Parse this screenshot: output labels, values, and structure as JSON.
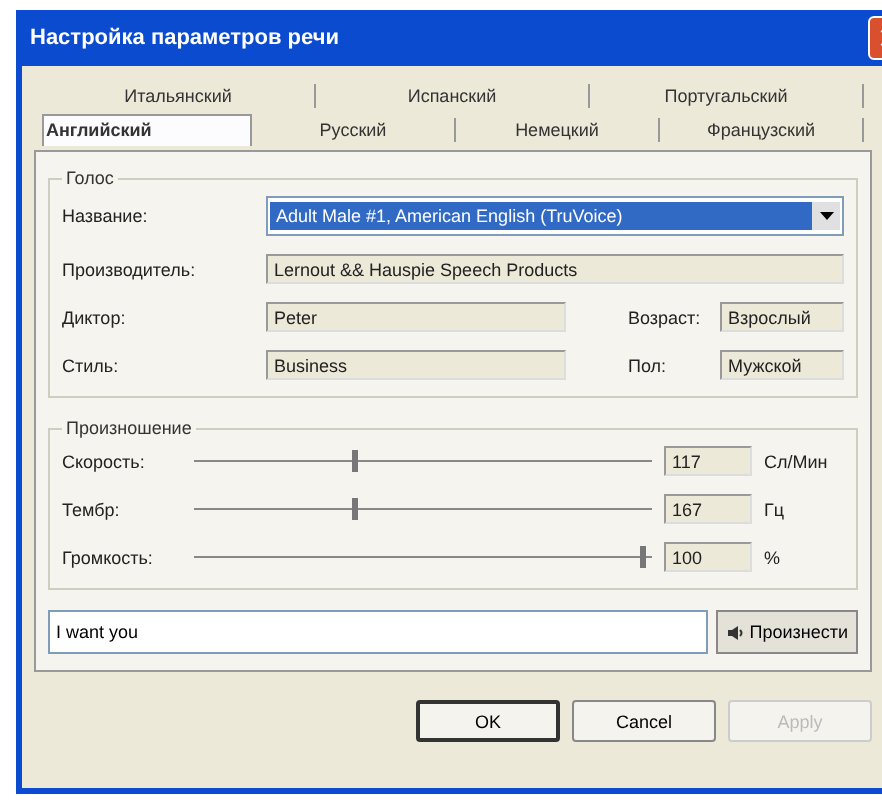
{
  "window": {
    "title": "Настройка параметров речи"
  },
  "tab_rows": [
    [
      {
        "label": "Итальянский",
        "selected": false
      },
      {
        "label": "Испанский",
        "selected": false
      },
      {
        "label": "Португальский",
        "selected": false
      }
    ],
    [
      {
        "label": "Английский",
        "selected": true
      },
      {
        "label": "Русский",
        "selected": false
      },
      {
        "label": "Немецкий",
        "selected": false
      },
      {
        "label": "Французский",
        "selected": false
      }
    ]
  ],
  "voice": {
    "title": "Голос",
    "name_label": "Название:",
    "name_value": "Adult Male #1, American English (TruVoice)",
    "maker_label": "Производитель:",
    "maker_value": "Lernout && Hauspie Speech Products",
    "speaker_label": "Диктор:",
    "speaker_value": "Peter",
    "age_label": "Возраст:",
    "age_value": "Взрослый",
    "style_label": "Стиль:",
    "style_value": "Business",
    "gender_label": "Пол:",
    "gender_value": "Мужской"
  },
  "pronunciation": {
    "title": "Произношение",
    "sliders": [
      {
        "label": "Скорость:",
        "level": 0.35,
        "reading": "117",
        "unit": "Сл/Мин"
      },
      {
        "label": "Тембр:",
        "level": 0.35,
        "reading": "167",
        "unit": "Гц"
      },
      {
        "label": "Громкость:",
        "level": 0.98,
        "reading": "100",
        "unit": "%"
      }
    ]
  },
  "test": {
    "value": "I want you",
    "button": "Произнести"
  },
  "buttons": [
    {
      "label": "OK",
      "disabled": false,
      "default": true
    },
    {
      "label": "Cancel",
      "disabled": false,
      "default": false
    },
    {
      "label": "Apply",
      "disabled": true,
      "default": false
    }
  ]
}
